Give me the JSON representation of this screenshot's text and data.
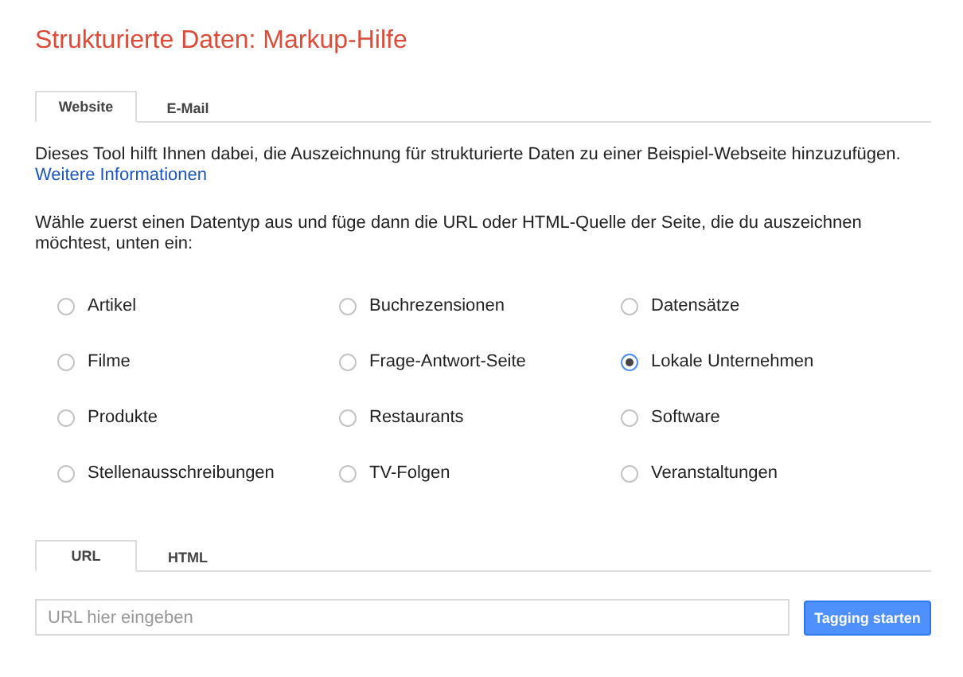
{
  "title": "Strukturierte Daten: Markup-Hilfe",
  "source_tabs": [
    {
      "label": "Website",
      "selected": true
    },
    {
      "label": "E-Mail",
      "selected": false
    }
  ],
  "intro": {
    "text": "Dieses Tool hilft Ihnen dabei, die Auszeichnung für strukturierte Daten zu einer Beispiel-Webseite hinzuzufügen.",
    "link": "Weitere Informationen"
  },
  "instruction": "Wähle zuerst einen Datentyp aus und füge dann die URL oder HTML-Quelle der Seite, die du auszeichnen möchtest, unten ein:",
  "data_types": [
    {
      "label": "Artikel",
      "selected": false
    },
    {
      "label": "Buchrezensionen",
      "selected": false
    },
    {
      "label": "Datensätze",
      "selected": false
    },
    {
      "label": "Filme",
      "selected": false
    },
    {
      "label": "Frage-Antwort-Seite",
      "selected": false
    },
    {
      "label": "Lokale Unternehmen",
      "selected": true
    },
    {
      "label": "Produkte",
      "selected": false
    },
    {
      "label": "Restaurants",
      "selected": false
    },
    {
      "label": "Software",
      "selected": false
    },
    {
      "label": "Stellenausschreibungen",
      "selected": false
    },
    {
      "label": "TV-Folgen",
      "selected": false
    },
    {
      "label": "Veranstaltungen",
      "selected": false
    }
  ],
  "input_tabs": [
    {
      "label": "URL",
      "selected": true
    },
    {
      "label": "HTML",
      "selected": false
    }
  ],
  "url_field": {
    "placeholder": "URL hier eingeben"
  },
  "submit_button": "Tagging starten"
}
